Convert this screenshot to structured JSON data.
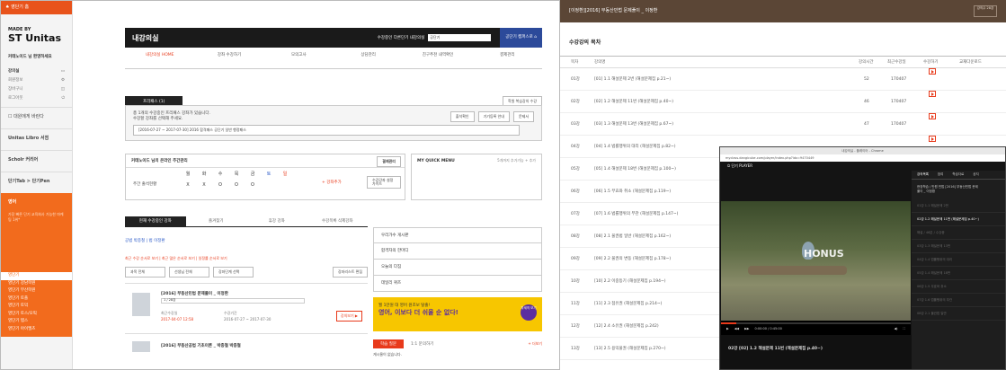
{
  "sidebar": {
    "home": "♠ 영단기 홈",
    "made_by": "MADE BY",
    "brand": "ST Unitas",
    "login_label": "커테노이드 님 환영하세요",
    "rows": [
      {
        "label": "강의실",
        "icon": "book-icon"
      },
      {
        "label": "회원정보",
        "icon": "gear-icon"
      },
      {
        "label": "장바구니",
        "icon": "cart-icon"
      },
      {
        "label": "로그아웃",
        "icon": "power-icon"
      }
    ],
    "hint": "대원에게 바란다",
    "libro": "Unitas Libro 서점",
    "scholar": "Scholr 커리어",
    "tab": "단기Tab > 단기Pen",
    "orange_title": "영어",
    "orange_sub": "가장 빠른 단기 교육회사 가능한 마케팅 1위*",
    "menu": [
      "영단기",
      "영단기 강남학원",
      "영단기 부산학원",
      "영단기 토플",
      "영단기 토익",
      "영단기 토스/오픽",
      "영단기 텝스",
      "영단기 아이엘츠"
    ]
  },
  "main": {
    "title": "내강의실",
    "switch_label": "수강중인 다른단기 내강의실",
    "switch_value": "공단기",
    "goto": "공단기 캠퍼스로 ⌂",
    "tabs": [
      "내강의실 HOME",
      "강좌 수강하기",
      "모의고사",
      "상담관리",
      "친구추천 내역확인",
      "결제관리"
    ],
    "premium_tab": "프리패스 (1)",
    "study_btn": "학원 복습강의 수강",
    "pass_text1": "총 1개의 수강중인 프리패스 강좌가 있습니다.",
    "pass_text2": "수강할 강좌를 선택해 주세요.",
    "pass_btns": [
      "출석확인",
      "기기등록 안내",
      "문제서"
    ],
    "pass_select": "[2016-07-27 ~ 2017-07-30] 2016 합격패스 공단기 일반 행정패스",
    "week_title": "커테노이드 님의 온라인 주간관리",
    "week_btn": "결제관리",
    "days": [
      "월",
      "화",
      "수",
      "목",
      "금",
      "토",
      "일"
    ],
    "marks": [
      "X",
      "X",
      "O",
      "O",
      "O",
      "",
      ""
    ],
    "week_label": "주간 출석현황",
    "add_btn": "+ 강좌추가",
    "guide_btn": "수강강좌 설정 가이드",
    "quick_title": "MY QUICK MENU",
    "quick_sub": "5개까지 추가가능 + 추가",
    "lec_tabs": [
      "현재 수강중인 강좌",
      "즐겨찾기",
      "휴강 강좌",
      "수강목록 삭제강좌"
    ],
    "lec_filter": "공법 박종철 | 법 이정환",
    "lec_recent": "최근 수강 순서로 보기 | 최근 많은 순서로 보기 | 일정률 순서로 보기",
    "lec_selects": [
      "과목 전체",
      "선생님 전체",
      "강좌단계 선택"
    ],
    "lec_btn": "강좌리스트 편집",
    "course1": {
      "title": "[2016] 부동산민법 문제풀이 _ 이정환",
      "progress": "1 / 28강",
      "recent_label": "최근수강일",
      "recent_date": "2017-04-07 12:58",
      "period_label": "수강기간",
      "period": "2016-07-27 ~ 2017-07-30",
      "btn": "강의보기 ▶"
    },
    "course2": {
      "title": "[2016] 부동산공법 기초이론 _ 박종철 박종철"
    },
    "side_links": [
      "우리가수 게시판",
      "합격자의 한마디",
      "오늘의 다짐",
      "데일리 퀴즈"
    ],
    "banner1": "월 1만원 대 영어 원조보 탈출!",
    "banner2": "영어, 이보다 더 쉬울 순 없다!",
    "banner_btn": "자세히 보기",
    "qa_tabs": [
      "학습 질문",
      "1:1 문의하기"
    ],
    "qa_more": "+ 더보기",
    "qa_empty": "게시물이 없습니다."
  },
  "right": {
    "header": "[이정환][2016] 부동산민법 문제풀이 _ 이정환",
    "done": "강의수 28강",
    "list_title": "수강강의 목차",
    "cols": [
      "목차",
      "강의명",
      "강의시간",
      "최근수강일",
      "수강하기",
      "교재다운로드"
    ],
    "rows": [
      {
        "no": "01강",
        "name": "[01] 1.1 해설문제 2번 (해설문제집 p.21~)",
        "time": "52",
        "date": "170407"
      },
      {
        "no": "02강",
        "name": "[02] 1.2 해설문제 11번 (해설문제집 p.40~)",
        "time": "46",
        "date": "170407"
      },
      {
        "no": "03강",
        "name": "[03] 1.3 해설문제 13번 (해설문제집 p.67~)",
        "time": "47",
        "date": "170407"
      },
      {
        "no": "04강",
        "name": "[04] 1.4 법률행위의 대리 (해설문제집 p.82~)",
        "time": "",
        "date": ""
      },
      {
        "no": "05강",
        "name": "[05] 1.4 해설문제 18번 (해설문제집 p.100~)",
        "time": "",
        "date": ""
      },
      {
        "no": "06강",
        "name": "[06] 1.5 무효와 취소 (해설문제집 p.119~)",
        "time": "",
        "date": ""
      },
      {
        "no": "07강",
        "name": "[07] 1.6 법률행위의 부관 (해설문제집 p.147~)",
        "time": "",
        "date": ""
      },
      {
        "no": "08강",
        "name": "[08] 2.1 물권법 일반 (해설문제집 p.162~)",
        "time": "",
        "date": ""
      },
      {
        "no": "09강",
        "name": "[09] 2.2 물권의 변동 (해설문제집 p.178~)",
        "time": "",
        "date": ""
      },
      {
        "no": "10강",
        "name": "[10] 2.2 이중등기 (해설문제집 p.194~)",
        "time": "",
        "date": ""
      },
      {
        "no": "11강",
        "name": "[11] 2.3 점유권 (해설문제집 p.214~)",
        "time": "",
        "date": ""
      },
      {
        "no": "12강",
        "name": "[12] 2.4 소유권 (해설문제집 p.242)",
        "time": "",
        "date": ""
      },
      {
        "no": "13강",
        "name": "[13] 2.5 용익물권 (해설문제집 p.270~)",
        "time": "",
        "date": ""
      }
    ]
  },
  "player": {
    "titlebar": "내강의실 - 플레이어 - Chrome",
    "address": "myclass.dangicube.com/player/index.php?idx=9470449",
    "logo": "단기 PLAYER",
    "watermark": "HONUS",
    "time_label": "0:00:00 / 0:45:00",
    "bottom_title": "02강 [02] 1.2 해설문제 11번 (해설문제집 p.40~)",
    "side_tabs": [
      "강의목록",
      "참여",
      "학습자료",
      "공지"
    ],
    "side_info": "현장학습 / 만원 민법 [2016] 부동산민법 문제풀이 _ 이정환",
    "side_rows": [
      "01강 1.1 해설문제 2번",
      "02강 1.2 해설문제 11번 (해설문제집 p.40~)",
      "해설 / 46분 / 수강중",
      "03강 1.3 해설문제 13번",
      "04강 1.4 법률행위의 대리",
      "05강 1.4 해설문제 18번",
      "06강 1.5 무효와 취소",
      "07강 1.6 법률행위의 부관",
      "08강 2.1 물권법 일반"
    ]
  }
}
